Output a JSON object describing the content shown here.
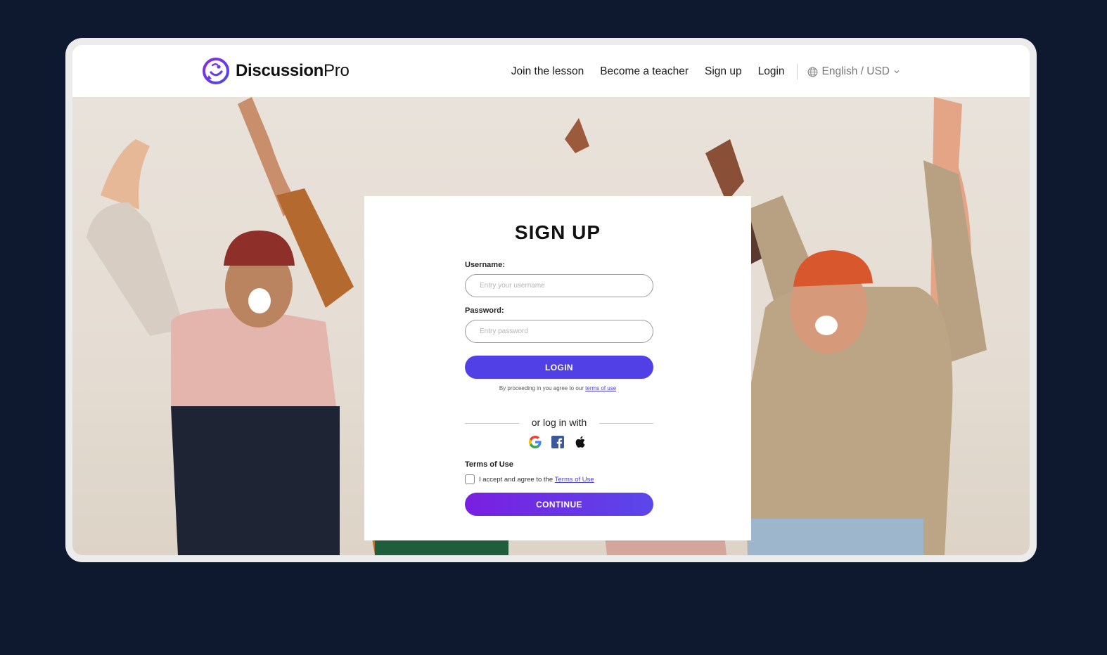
{
  "brand": {
    "name_bold": "Discussion",
    "name_light": "Pro"
  },
  "nav": {
    "links": [
      "Join the lesson",
      "Become a teacher",
      "Sign up",
      "Login"
    ],
    "language": "English / USD"
  },
  "signup": {
    "title": "SIGN UP",
    "username_label": "Username:",
    "username_placeholder": "Entry your username",
    "password_label": "Password:",
    "password_placeholder": "Entry password",
    "login_button": "LOGIN",
    "legal_text": "By proceeding in you agree to our ",
    "legal_link": "terms of use",
    "alt_login_text": "or log in with",
    "social_icons": [
      "google-icon",
      "facebook-icon",
      "apple-icon"
    ],
    "terms_heading": "Terms of Use",
    "agree_text": "I accept and agree to the ",
    "agree_link": "Terms of Use",
    "agree_checked": false,
    "continue_button": "CONTINUE"
  },
  "colors": {
    "page_bg": "#0e1930",
    "primary": "#5140e6",
    "gradient_start": "#7a1fe0",
    "gradient_end": "#5a47ea"
  }
}
